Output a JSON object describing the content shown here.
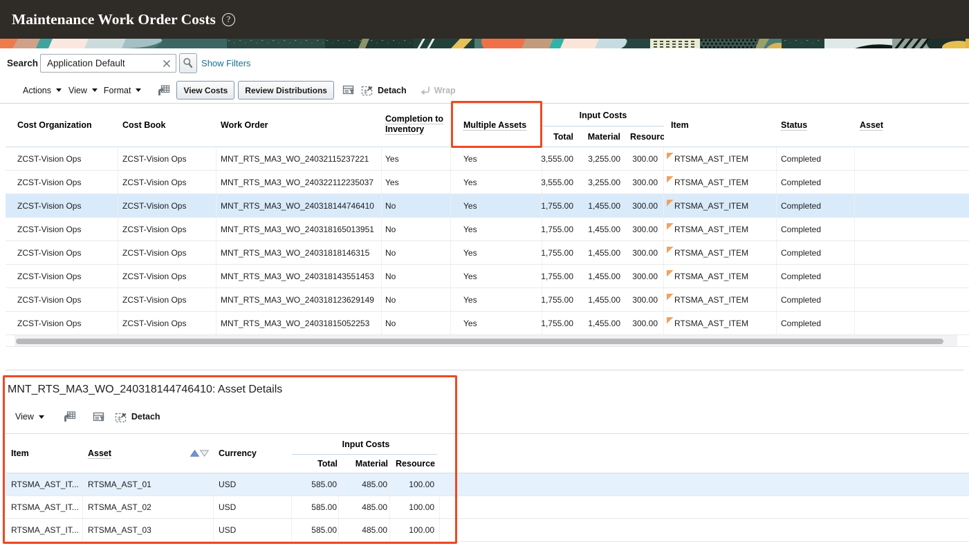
{
  "header": {
    "title": "Maintenance Work Order Costs",
    "help_glyph": "?"
  },
  "search": {
    "label": "Search",
    "value": "Application Default",
    "show_filters": "Show Filters"
  },
  "toolbar": {
    "actions": "Actions",
    "view": "View",
    "format": "Format",
    "view_costs": "View Costs",
    "review_distributions": "Review Distributions",
    "detach": "Detach",
    "wrap": "Wrap"
  },
  "table": {
    "group_header": "Input Costs",
    "columns": [
      {
        "label": "Cost Organization"
      },
      {
        "label": "Cost Book"
      },
      {
        "label": "Work Order"
      },
      {
        "label": "Completion to Inventory"
      },
      {
        "label": "Multiple Assets"
      },
      {
        "label": "Total"
      },
      {
        "label": "Material"
      },
      {
        "label": "Resource"
      },
      {
        "label": "Item"
      },
      {
        "label": "Status"
      },
      {
        "label": "Asset"
      }
    ],
    "rows": [
      {
        "co": "ZCST-Vision Ops",
        "book": "ZCST-Vision Ops",
        "wo": "MNT_RTS_MA3_WO_24032115237221",
        "completion": "Yes",
        "multiple": "Yes",
        "total": "3,555.00",
        "material": "3,255.00",
        "resource": "300.00",
        "item": "RTSMA_AST_ITEM",
        "status": "Completed",
        "asset": ""
      },
      {
        "co": "ZCST-Vision Ops",
        "book": "ZCST-Vision Ops",
        "wo": "MNT_RTS_MA3_WO_240322112235037",
        "completion": "Yes",
        "multiple": "Yes",
        "total": "3,555.00",
        "material": "3,255.00",
        "resource": "300.00",
        "item": "RTSMA_AST_ITEM",
        "status": "Completed",
        "asset": ""
      },
      {
        "co": "ZCST-Vision Ops",
        "book": "ZCST-Vision Ops",
        "wo": "MNT_RTS_MA3_WO_240318144746410",
        "completion": "No",
        "multiple": "Yes",
        "total": "1,755.00",
        "material": "1,455.00",
        "resource": "300.00",
        "item": "RTSMA_AST_ITEM",
        "status": "Completed",
        "asset": "",
        "selected": true
      },
      {
        "co": "ZCST-Vision Ops",
        "book": "ZCST-Vision Ops",
        "wo": "MNT_RTS_MA3_WO_240318165013951",
        "completion": "No",
        "multiple": "Yes",
        "total": "1,755.00",
        "material": "1,455.00",
        "resource": "300.00",
        "item": "RTSMA_AST_ITEM",
        "status": "Completed",
        "asset": ""
      },
      {
        "co": "ZCST-Vision Ops",
        "book": "ZCST-Vision Ops",
        "wo": "MNT_RTS_MA3_WO_24031818146315",
        "completion": "No",
        "multiple": "Yes",
        "total": "1,755.00",
        "material": "1,455.00",
        "resource": "300.00",
        "item": "RTSMA_AST_ITEM",
        "status": "Completed",
        "asset": ""
      },
      {
        "co": "ZCST-Vision Ops",
        "book": "ZCST-Vision Ops",
        "wo": "MNT_RTS_MA3_WO_240318143551453",
        "completion": "No",
        "multiple": "Yes",
        "total": "1,755.00",
        "material": "1,455.00",
        "resource": "300.00",
        "item": "RTSMA_AST_ITEM",
        "status": "Completed",
        "asset": ""
      },
      {
        "co": "ZCST-Vision Ops",
        "book": "ZCST-Vision Ops",
        "wo": "MNT_RTS_MA3_WO_240318123629149",
        "completion": "No",
        "multiple": "Yes",
        "total": "1,755.00",
        "material": "1,455.00",
        "resource": "300.00",
        "item": "RTSMA_AST_ITEM",
        "status": "Completed",
        "asset": ""
      },
      {
        "co": "ZCST-Vision Ops",
        "book": "ZCST-Vision Ops",
        "wo": "MNT_RTS_MA3_WO_24031815052253",
        "completion": "No",
        "multiple": "Yes",
        "total": "1,755.00",
        "material": "1,455.00",
        "resource": "300.00",
        "item": "RTSMA_AST_ITEM",
        "status": "Completed",
        "asset": ""
      }
    ]
  },
  "detail": {
    "title": "MNT_RTS_MA3_WO_240318144746410: Asset Details",
    "toolbar": {
      "view": "View",
      "detach": "Detach"
    },
    "group_header": "Input Costs",
    "columns": [
      {
        "label": "Item"
      },
      {
        "label": "Asset"
      },
      {
        "label": "Currency"
      },
      {
        "label": "Total"
      },
      {
        "label": "Material"
      },
      {
        "label": "Resource"
      }
    ],
    "rows": [
      {
        "item": "RTSMA_AST_IT...",
        "asset": "RTSMA_AST_01",
        "currency": "USD",
        "total": "585.00",
        "material": "485.00",
        "resource": "100.00",
        "selected": true
      },
      {
        "item": "RTSMA_AST_IT...",
        "asset": "RTSMA_AST_02",
        "currency": "USD",
        "total": "585.00",
        "material": "485.00",
        "resource": "100.00"
      },
      {
        "item": "RTSMA_AST_IT...",
        "asset": "RTSMA_AST_03",
        "currency": "USD",
        "total": "585.00",
        "material": "485.00",
        "resource": "100.00"
      }
    ]
  },
  "colors": {
    "highlight": "#ef4823",
    "selected_row": "#d9eafa",
    "link": "#15718f",
    "header_bg": "#2f2b26"
  }
}
